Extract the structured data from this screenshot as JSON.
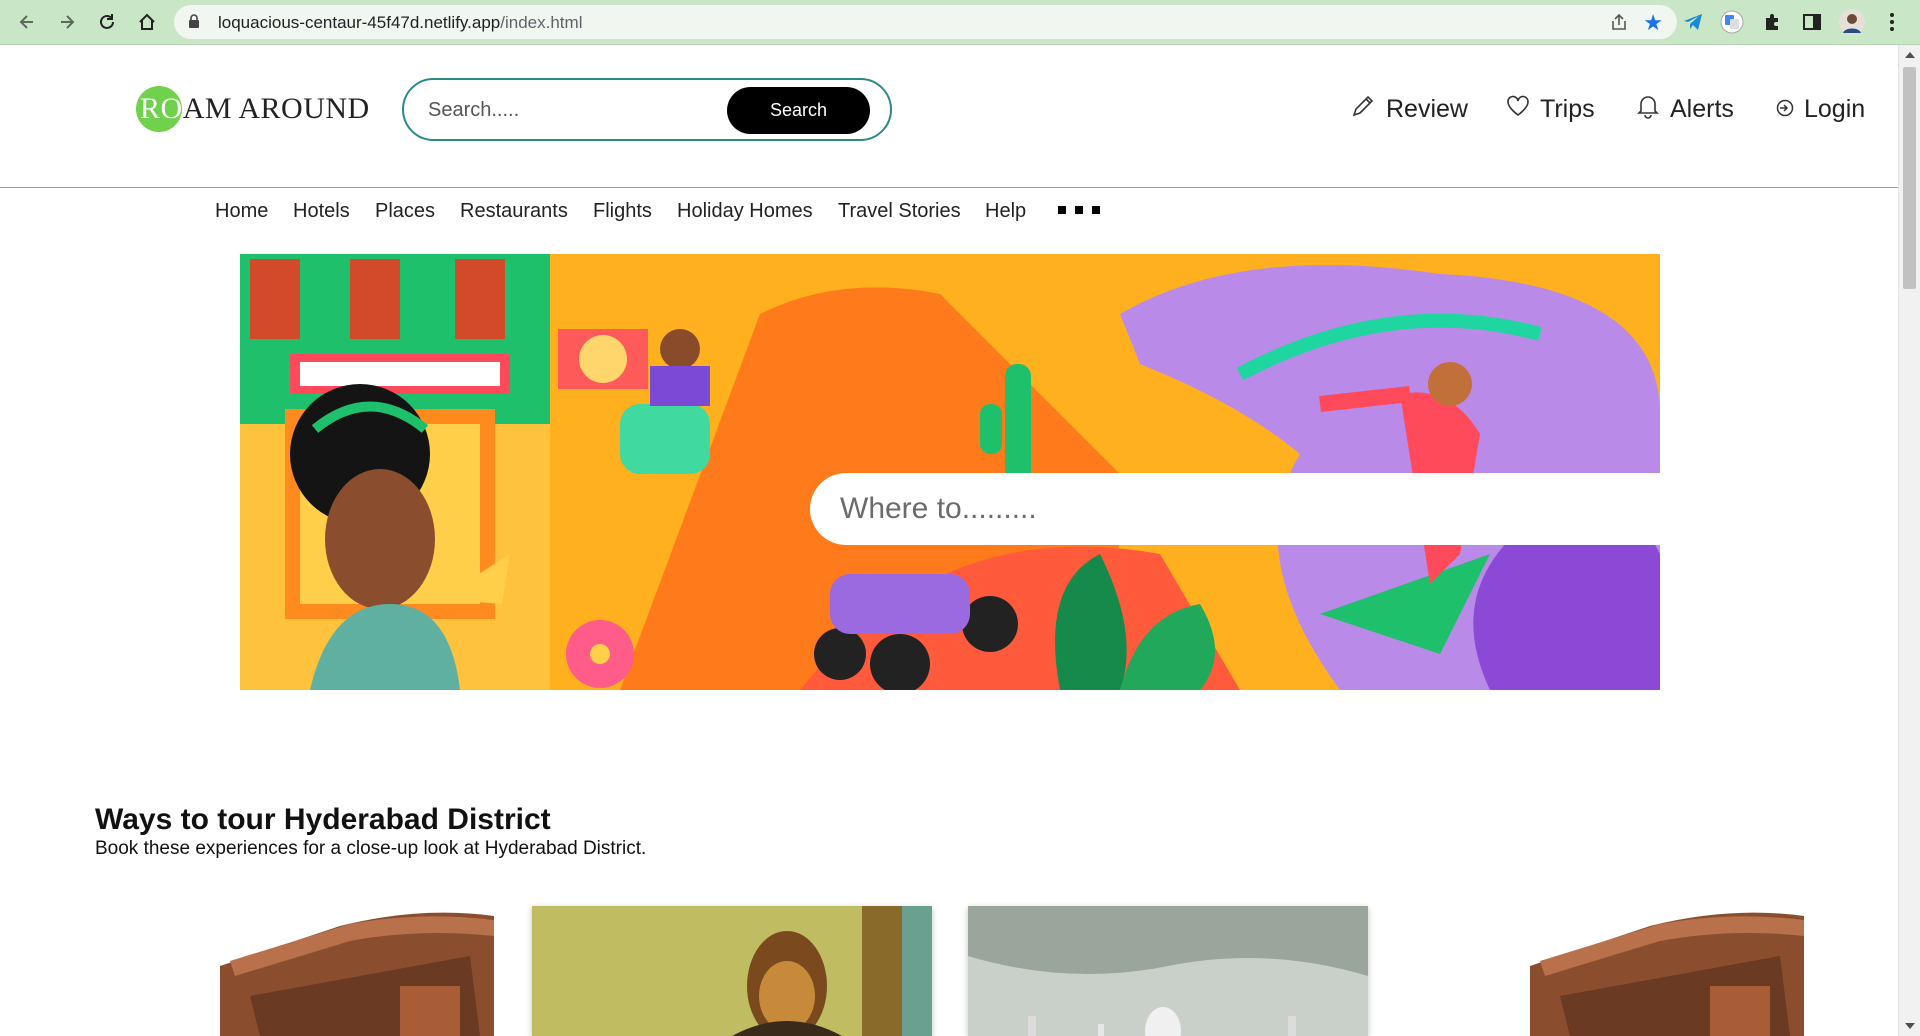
{
  "browser": {
    "url_host": "loquacious-centaur-45f47d.netlify.app",
    "url_path": "/index.html"
  },
  "header": {
    "logo_first": "RO",
    "logo_rest": "AM AROUND",
    "search_placeholder": "Search.....",
    "search_button": "Search",
    "links": {
      "review": "Review",
      "trips": "Trips",
      "alerts": "Alerts",
      "login": "Login"
    }
  },
  "menu": {
    "items": [
      "Home",
      "Hotels",
      "Places",
      "Restaurants",
      "Flights",
      "Holiday Homes",
      "Travel Stories",
      "Help"
    ]
  },
  "hero": {
    "where_placeholder": "Where to........."
  },
  "section": {
    "title": "Ways to tour Hyderabad District",
    "subtitle": "Book these experiences for a close-up look at Hyderabad District."
  },
  "colors": {
    "brand_green": "#6fd14c",
    "search_border": "#2b8a86",
    "chrome_bg": "#c9e6c7"
  },
  "icons": {
    "review": "pencil-icon",
    "trips": "heart-icon",
    "alerts": "bell-icon",
    "login": "login-arrow-icon"
  }
}
